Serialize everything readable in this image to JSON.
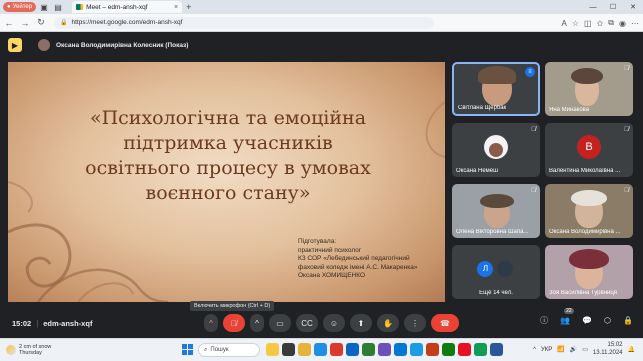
{
  "browser": {
    "profile_label": "Уейтер",
    "tab_title": "Meet – edm-ansh-xqf",
    "tab_close": "×",
    "new_tab": "+",
    "url": "https://meet.google.com/edm-ansh-xqf",
    "window_controls": [
      "—",
      "☐",
      "✕"
    ]
  },
  "presentation": {
    "presenter": "Оксана Володимирівна Колесник (Показ)",
    "slide_title_lines": [
      "«Психологічна та емоційна",
      "підтримка учасників",
      "освітнього процесу в умовах",
      "воєнного стану»"
    ],
    "author_lines": [
      "Підготувала:",
      "практичний психолог",
      "КЗ СОР «Лебединський педагогічний",
      "фаховий коледж імені А.С. Макаренка»",
      "Оксана ХОМИЩЕНКО"
    ]
  },
  "tooltip": "Включить микрофон (Ctrl + D)",
  "participants": [
    {
      "name": "Світлана Щербак",
      "avatar_letter": "",
      "color": "#6d6a66"
    },
    {
      "name": "Яна Минакова",
      "avatar_letter": "",
      "color": "#7c7868"
    },
    {
      "name": "Оксана Немеш",
      "avatar_letter": "",
      "color": "#f1f3f4"
    },
    {
      "name": "Валентина Миколаївна ...",
      "avatar_letter": "В",
      "color": "#c5221f"
    },
    {
      "name": "Олена Вікторовна Шапа...",
      "avatar_letter": "",
      "color": "#8a8f97"
    },
    {
      "name": "Оксана Володимирівна ...",
      "avatar_letter": "",
      "color": "#9a8b73"
    },
    {
      "name": "Ещё 14 чел.",
      "avatar_letter": "Л",
      "color": "#1a73e8"
    },
    {
      "name": "Зоя Василівна Турвниця",
      "avatar_letter": "",
      "color": "#7a5f6d"
    }
  ],
  "bottom_bar": {
    "time": "15:02",
    "separator": "|",
    "meeting_code": "edm-ansh-xqf",
    "people_count": "22"
  },
  "taskbar": {
    "weather_temp": "2 cm of snow",
    "weather_day": "Thursday",
    "search_placeholder": "Пошук",
    "lang": "УКР",
    "time": "15:02",
    "date": "13.11.2024"
  },
  "colors": {
    "meet_bg": "#202124",
    "tile_bg": "#3c4043",
    "leave_red": "#ea4335",
    "slide_text": "#6b3b1e"
  }
}
